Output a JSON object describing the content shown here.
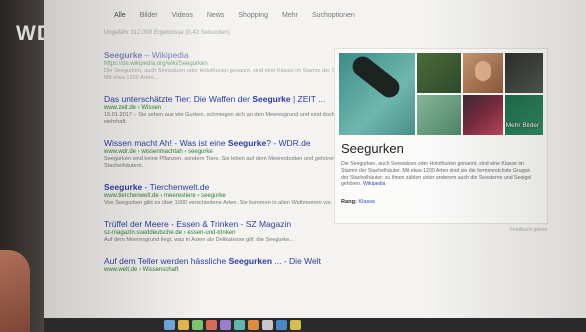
{
  "broadcaster_logo": "WDR",
  "search": {
    "tabs": [
      "Alle",
      "Bilder",
      "Videos",
      "News",
      "Shopping",
      "Mehr",
      "Suchoptionen"
    ],
    "active_tab": 0,
    "result_stats": "Ungefähr 312.000 Ergebnisse (0,42 Sekunden)"
  },
  "results": [
    {
      "title_pre": "",
      "title_bold": "Seegurke",
      "title_post": " – Wikipedia",
      "url": "https://de.wikipedia.org/wiki/Seegurken",
      "snippet": "Die Seegurken, auch Seewalzen oder Holothurien genannt, sind eine Klasse im Stamm der Stachelhäuter. Mit etwa 1200 Arten..."
    },
    {
      "title_pre": "Das unterschätzte Tier: Die Waffen der ",
      "title_bold": "Seegurke",
      "title_post": " | ZEIT ...",
      "url": "www.zeit.de › Wissen",
      "snippet": "15.01.2017 – Sie sehen aus wie Gurken, schmiegen sich an den Meeresgrund und sind doch überraschend wehrhaft."
    },
    {
      "title_pre": "Wissen macht Ah! - Was ist eine ",
      "title_bold": "Seegurke",
      "title_post": "? - WDR.de",
      "url": "www.wdr.de › wissenmachtah › seegurke",
      "snippet": "Seegurken sind keine Pflanzen, sondern Tiere. Sie leben auf dem Meeresboden und gehören zu den Stachelhäutern."
    },
    {
      "title_pre": "",
      "title_bold": "Seegurke",
      "title_post": " - Tierchenwelt.de",
      "url": "www.tierchenwelt.de › meerestiere › seegurke",
      "snippet": "Von Seegurken gibt es über 1000 verschiedene Arten. Sie kommen in allen Weltmeeren vor."
    },
    {
      "title_pre": "Trüffel der Meere - Essen & Trinken - SZ Magazin",
      "title_bold": "",
      "title_post": "",
      "url": "sz-magazin.sueddeutsche.de › essen-und-trinken",
      "snippet": "Auf dem Meeresgrund liegt, was in Asien als Delikatesse gilt: die Seegurke..."
    },
    {
      "title_pre": "Auf dem Teller werden hässliche ",
      "title_bold": "Seegurken",
      "title_post": " ... - Die Welt",
      "url": "www.welt.de › Wissenschaft",
      "snippet": ""
    }
  ],
  "knowledge_panel": {
    "title": "Seegurken",
    "more_images": "Mehr Bilder",
    "description": "Die Seegurken, auch Seewalzen oder Holothurien genannt, sind eine Klasse im Stamm der Stachelhäuter. Mit etwa 1200 Arten sind sie die formenreichste Gruppe der Stachelhäuter; zu ihnen zählen unter anderem auch die Seesterne und Seeigel gehören.",
    "source": "Wikipedia",
    "rank_label": "Rang:",
    "rank_value": "Klasse"
  },
  "feedback_label": "Feedback geben",
  "colors": {
    "link": "#2b3ea3",
    "url_green": "#2e7d32",
    "screen_bg": "#f4f3f1"
  }
}
